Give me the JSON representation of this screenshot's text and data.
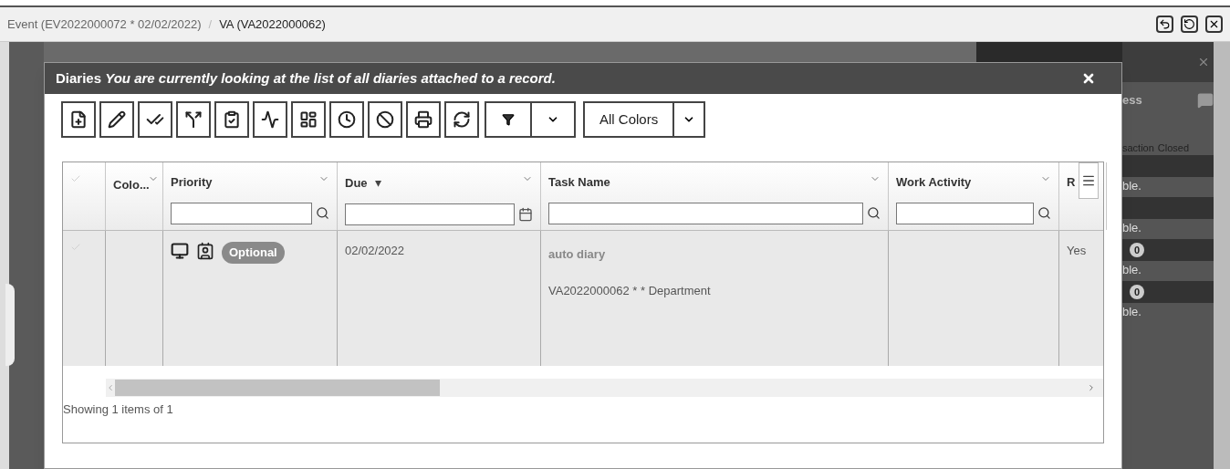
{
  "breadcrumb": [
    {
      "label": "Event (EV2022000072 * 02/02/2022)",
      "selected": false
    },
    {
      "separator": "/",
      "label": "VA (VA2022000062)",
      "selected": true
    }
  ],
  "modal": {
    "title": "Diaries",
    "subtitle": "You are currently looking at the list of all diaries attached to a record.",
    "color_filter": {
      "value": "All Colors"
    }
  },
  "grid": {
    "columns": [
      {
        "kind": "check"
      },
      {
        "kind": "plain",
        "label": "Colo..."
      },
      {
        "kind": "search",
        "label": "Priority"
      },
      {
        "kind": "date",
        "label": "Due",
        "sort_icon": "▾"
      },
      {
        "kind": "search",
        "label": "Task Name"
      },
      {
        "kind": "search",
        "label": "Work Activity"
      },
      {
        "kind": "menu",
        "label": "R"
      }
    ],
    "rows": [
      {
        "selected": false,
        "due": "02/02/2022",
        "priority": "Optional",
        "task_name": "auto diary",
        "task_detail": "VA2022000062 * * Department",
        "column_7": "Yes"
      }
    ],
    "footer": "Showing 1 items of 1"
  },
  "background_panel": {
    "heading": "ess",
    "tiles": [
      "saction",
      "Closed"
    ],
    "rows": [
      {
        "text": "ble."
      },
      {
        "text": "ble."
      },
      {
        "badge": "0",
        "text": "ble."
      },
      {
        "badge": "0",
        "text": "ble."
      }
    ]
  }
}
